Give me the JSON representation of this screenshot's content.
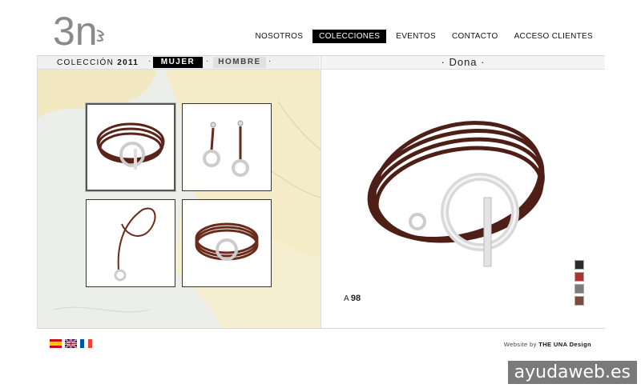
{
  "brand": {
    "logo_text": "3n"
  },
  "nav": {
    "items": [
      {
        "label": "NOSOTROS",
        "active": false
      },
      {
        "label": "COLECCIONES",
        "active": true
      },
      {
        "label": "EVENTOS",
        "active": false
      },
      {
        "label": "CONTACTO",
        "active": false
      },
      {
        "label": "ACCESO CLIENTES",
        "active": false
      }
    ]
  },
  "collection": {
    "label": "COLECCIÓN",
    "year": "2011",
    "tabs": [
      {
        "label": "MUJER",
        "active": true
      },
      {
        "label": "HOMBRE",
        "active": false
      }
    ],
    "separator": "·"
  },
  "product": {
    "title": "· Dona ·",
    "ref_prefix": "A",
    "ref_number": "98",
    "swatches": [
      "#2a2a2a",
      "#b03030",
      "#7c7c7c",
      "#7a4a3c"
    ]
  },
  "thumbnails": [
    {
      "name": "bracelet-toggle",
      "selected": true
    },
    {
      "name": "earrings",
      "selected": false
    },
    {
      "name": "pendant-necklace",
      "selected": false
    },
    {
      "name": "bracelet-ring",
      "selected": false
    }
  ],
  "languages": [
    "es",
    "en",
    "fr"
  ],
  "footer": {
    "credit_prefix": "Website by",
    "credit_name": "THE UNA Design"
  },
  "watermark": "ayudaweb.es"
}
